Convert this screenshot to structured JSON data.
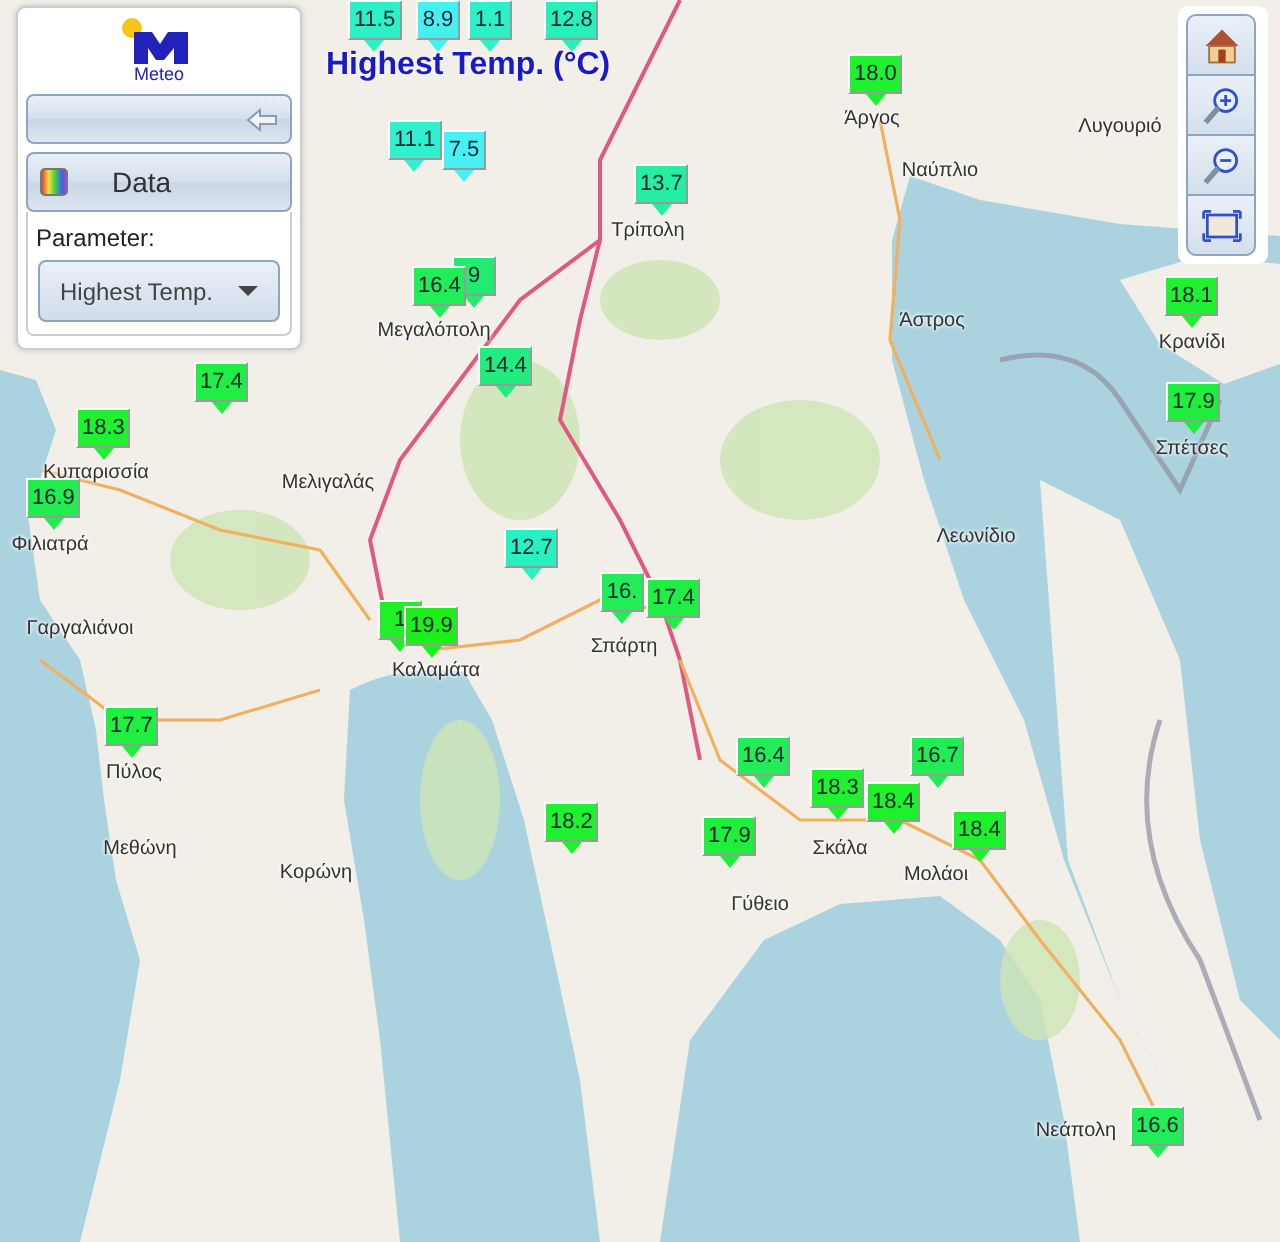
{
  "title": "Highest Temp. (°C)",
  "panel": {
    "logo_text": "Meteo",
    "data_button": "Data",
    "parameter_label": "Parameter:",
    "parameter_select": {
      "value": "Highest Temp."
    }
  },
  "toolbar": [
    {
      "kind": "home"
    },
    {
      "kind": "zoom_in"
    },
    {
      "kind": "zoom_out"
    },
    {
      "kind": "extent"
    }
  ],
  "places": [
    {
      "name": "Άργος"
    },
    {
      "name": "Ναύπλιο"
    },
    {
      "name": "Λυγουριό"
    },
    {
      "name": "Τρίπολη"
    },
    {
      "name": "Άστρος"
    },
    {
      "name": "Κρανίδι"
    },
    {
      "name": "Σπέτσες"
    },
    {
      "name": "Μεγαλόπολη"
    },
    {
      "name": "Κυπαρισσία"
    },
    {
      "name": "Μελιγαλάς"
    },
    {
      "name": "Φιλιατρά"
    },
    {
      "name": "Λεωνίδιο"
    },
    {
      "name": "Γαργαλιάνοι"
    },
    {
      "name": "Καλαμάτα"
    },
    {
      "name": "Σπάρτη"
    },
    {
      "name": "Πύλος"
    },
    {
      "name": "Μεθώνη"
    },
    {
      "name": "Κορώνη"
    },
    {
      "name": "Σκάλα"
    },
    {
      "name": "Μολάοι"
    },
    {
      "name": "Γύθειο"
    },
    {
      "name": "Νεάπολη"
    }
  ],
  "stations": [
    {
      "value": "11.5",
      "color": "#2ef0c8"
    },
    {
      "value": "8.9",
      "color": "#45f0f0"
    },
    {
      "value": "1.1",
      "color": "#2ef0c8"
    },
    {
      "value": "12.8",
      "color": "#28f0b8"
    },
    {
      "value": "11.1",
      "color": "#30f0d0"
    },
    {
      "value": "7.5",
      "color": "#48f0f4"
    },
    {
      "value": "9",
      "color": "#22ec70"
    },
    {
      "value": "16.4",
      "color": "#22ec58"
    },
    {
      "value": "14.4",
      "color": "#22ec80"
    },
    {
      "value": "13.7",
      "color": "#26eea0"
    },
    {
      "value": "18.0",
      "color": "#1ff030"
    },
    {
      "value": "18.1",
      "color": "#1ff030"
    },
    {
      "value": "17.9",
      "color": "#20ee3c"
    },
    {
      "value": "17.4",
      "color": "#20ee44"
    },
    {
      "value": "18.3",
      "color": "#1ff030"
    },
    {
      "value": "16.9",
      "color": "#22ec50"
    },
    {
      "value": "12.7",
      "color": "#28f0c0"
    },
    {
      "value": "1",
      "color": "#1ff028"
    },
    {
      "value": "19.9",
      "color": "#1cf018"
    },
    {
      "value": "16.",
      "color": "#22ec58"
    },
    {
      "value": "17.4",
      "color": "#20ee44"
    },
    {
      "value": "17.7",
      "color": "#20ee40"
    },
    {
      "value": "18.2",
      "color": "#1ff030"
    },
    {
      "value": "16.4",
      "color": "#22ec58"
    },
    {
      "value": "18.3",
      "color": "#1ff030"
    },
    {
      "value": "18.4",
      "color": "#1ff02c"
    },
    {
      "value": "16.7",
      "color": "#22ec54"
    },
    {
      "value": "17.9",
      "color": "#20ee3c"
    },
    {
      "value": "18.4",
      "color": "#1ff02c"
    },
    {
      "value": "16.6",
      "color": "#22ec58"
    }
  ]
}
